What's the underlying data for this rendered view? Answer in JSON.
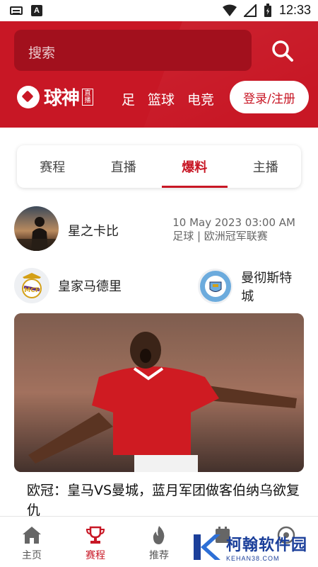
{
  "status_bar": {
    "time": "12:33"
  },
  "header": {
    "search_placeholder": "搜索",
    "logo_text": "球神",
    "logo_badge": "直播",
    "sports": [
      "足",
      "篮球",
      "电竞"
    ],
    "login_label": "登录/注册"
  },
  "tabs": [
    {
      "label": "赛程",
      "active": false
    },
    {
      "label": "直播",
      "active": false
    },
    {
      "label": "爆料",
      "active": true
    },
    {
      "label": "主播",
      "active": false
    }
  ],
  "post": {
    "author_name": "星之卡比",
    "datetime": "10 May 2023 03:00 AM",
    "category": "足球 | 欧洲冠军联赛",
    "home_team": "皇家马德里",
    "away_team": "曼彻斯特城",
    "title": "欧冠：皇马VS曼城，蓝月军团做客伯纳乌欲复仇"
  },
  "bottom_nav": [
    {
      "label": "主页",
      "icon": "home-icon"
    },
    {
      "label": "赛程",
      "icon": "trophy-icon"
    },
    {
      "label": "推荐",
      "icon": "flame-icon"
    },
    {
      "label": "",
      "icon": "calendar-icon"
    },
    {
      "label": "",
      "icon": "profile-icon"
    }
  ],
  "watermark": {
    "main": "柯翰软件园",
    "sub": "KEHAN38.COM"
  },
  "colors": {
    "brand_red": "#c81725",
    "search_bg": "#a2101d"
  }
}
